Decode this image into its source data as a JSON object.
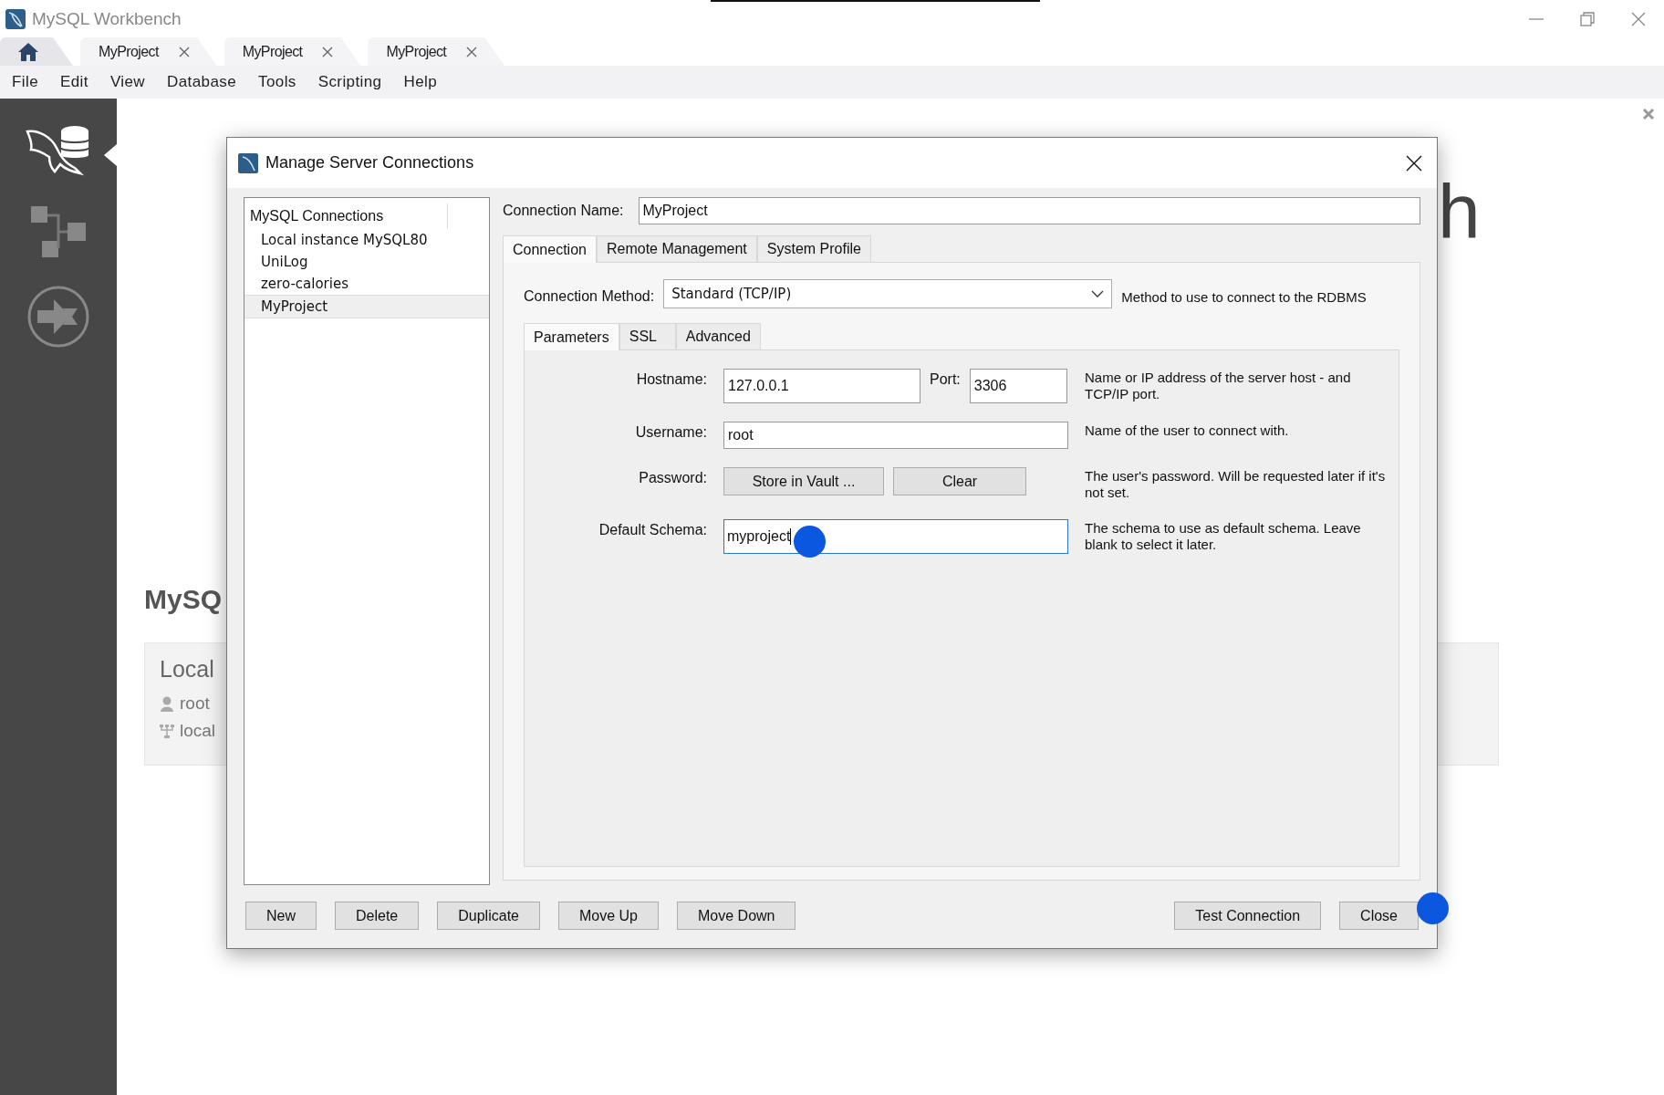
{
  "window": {
    "title": "MySQL Workbench"
  },
  "tabs": [
    {
      "kind": "home",
      "selected": true
    },
    {
      "kind": "connection",
      "label": "MyProject",
      "selected": false
    },
    {
      "kind": "connection",
      "label": "MyProject",
      "selected": false
    },
    {
      "kind": "connection",
      "label": "MyProject",
      "selected": false
    }
  ],
  "menu": [
    "File",
    "Edit",
    "View",
    "Database",
    "Tools",
    "Scripting",
    "Help"
  ],
  "home": {
    "title_fragment": "h",
    "heading": "MySQ",
    "card": {
      "title": "Local",
      "user": "root",
      "host": "local"
    }
  },
  "dialog": {
    "title": "Manage Server Connections",
    "list": {
      "header": "MySQL Connections",
      "items": [
        {
          "label": "Local instance MySQL80",
          "selected": false
        },
        {
          "label": "UniLog",
          "selected": false
        },
        {
          "label": "zero-calories",
          "selected": false
        },
        {
          "label": "MyProject",
          "selected": true
        }
      ]
    },
    "connection_name": {
      "label": "Connection Name:",
      "value": "MyProject"
    },
    "tabs": [
      {
        "label": "Connection",
        "selected": true
      },
      {
        "label": "Remote Management",
        "selected": false
      },
      {
        "label": "System Profile",
        "selected": false
      }
    ],
    "method": {
      "label": "Connection Method:",
      "value": "Standard (TCP/IP)",
      "hint": "Method to use to connect to the RDBMS"
    },
    "subtabs": [
      {
        "label": "Parameters",
        "selected": true
      },
      {
        "label": "SSL",
        "selected": false
      },
      {
        "label": "Advanced",
        "selected": false
      }
    ],
    "rows": [
      {
        "kind": "host_port",
        "label": "Hostname:",
        "value": "127.0.0.1",
        "port_label": "Port:",
        "port_value": "3306",
        "hint": "Name or IP address of the server host - and TCP/IP port."
      },
      {
        "kind": "text",
        "label": "Username:",
        "value": "root",
        "focused": false,
        "hint": "Name of the user to connect with."
      },
      {
        "kind": "buttons",
        "label": "Password:",
        "buttons": [
          "Store in Vault ...",
          "Clear"
        ],
        "hint": "The user's password. Will be requested later if it's not set."
      },
      {
        "kind": "text",
        "label": "Default Schema:",
        "value": "myproject",
        "focused": true,
        "hint": "The schema to use as default schema. Leave blank to select it later."
      }
    ],
    "buttons_left": [
      "New",
      "Delete",
      "Duplicate",
      "Move Up",
      "Move Down"
    ],
    "buttons_right": [
      "Test Connection",
      "Close"
    ]
  }
}
